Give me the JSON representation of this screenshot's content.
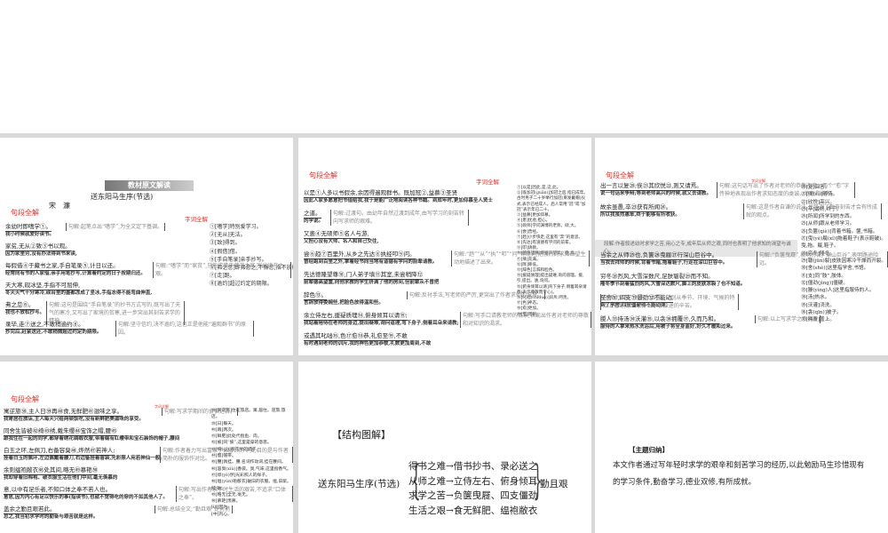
{
  "page1": {
    "banner": "教材原文解读",
    "title": "送东阳马生序(节选)",
    "author": "宋　濂",
    "section_label": "句段全解",
    "gloss_label": "字词全解",
    "lines": [
      {
        "text": "余幼时即嗜学①。",
        "trans": "我小时候就爱好读书。",
        "note": "句解:起笔点出“嗜学”,为全文定下基调。"
      },
      {
        "text": "家贫,无从②致③书以观。",
        "trans": "因为家里穷,没有办法得到书来读,"
      },
      {
        "text": "每假借④于藏书之家,手自笔录⑤,计日以还。",
        "trans": "经常向有书的人家借,亲手用笔抄写,计算着约定的日子按期归还。",
        "note": "句解:“嗜学”而“家贫”,只能求借于藏书之家,写出读书之艰。"
      },
      {
        "text": "天大寒,砚冰坚,手指不可屈伸,",
        "trans": "冬天天气十分寒冷,砚台里的墨都冻成了坚冰,手指冻得不能弯曲伸直,"
      },
      {
        "text": "弗之怠⑥。",
        "trans": "我也不放松抄写。",
        "note": "句解:这句是围绕“手自笔录”的抄书方式写的,既写出了天气的寒冷,又写出了家境的贫寒,进一步突出其刻苦求学的精神。"
      },
      {
        "text": "录毕,走⑦送之,不敢稍逾约⑧。",
        "trans": "抄完后,赶紧送还,不敢稍微超过约定的期限。",
        "note": "句解:坚守信约,决不逾约,这也正是他能“遍观群书”的原因。"
      }
    ],
    "gloss": [
      "①[嗜学]特别爱学习。",
      "②[无从]无法。",
      "③[致]得到。",
      "④[假借]借。",
      "⑤[手自笔录]亲手抄写。",
      "⑥[弗之怠]即弗怠之,不懈怠,指不放松抄书。弗,不。之,指代抄书。",
      "⑦[走]跑。",
      "⑧[逾约]超过约定的期限。"
    ]
  },
  "page2": {
    "section_label": "句段全解",
    "gloss_label": "字词全解",
    "lines": [
      {
        "text": "以是①人多以书假余,余因得遍观群书。既加冠②,益慕③圣贤",
        "trans": "因此人家多愿意把书借给我,我于是能广泛地阅读各种书籍。到成年时,更加仰慕圣人贤士"
      },
      {
        "text": "之道。",
        "trans": "的学说。",
        "note": "句解:过渡句。由幼年自然过渡到成年,由写学习的刻苦转向写求师的艰难。"
      },
      {
        "text": "又患④无硕师⑤名人与游,",
        "trans": "又担心没有大师、名人和自己交往,"
      },
      {
        "text": "尝⑥趋⑦百里外,从乡之先达⑧执经叩⑨问。",
        "trans": "曾经跑到百里之外,拿着经书向当地有道德有学问的前辈请教。",
        "note": "句解:“趋”“从”“执”“叩”“问”等动词,把强烈的求知欲望生动地描述了出来。"
      },
      {
        "text": "先达德隆望尊⑩,门人弟子填⑪其室,未尝稍降⑫",
        "trans": "前辈德高望重,向他求教的学生挤满了他的房间,但前辈从不曾把"
      },
      {
        "text": "辞色⑬。",
        "trans": "言辞放得委婉些,把脸色放得温和些。",
        "note": "句解:反衬手法,写老师的严厉,更突出了作者求师的诚恳。"
      },
      {
        "text": "余立侍左右,援疑质理⑭,俯身倾耳以请⑮;",
        "trans": "我站着陪侍在老师的身边,提出疑难,询问道理,弯下身子,侧着耳朵来请教;",
        "note": "句解:写手口请教老师的情景,表现出作者对老师的尊敬和对知识的渴求。"
      },
      {
        "text": "或遇其叱咄⑯,色⑰愈⑱恭,礼愈至⑲,不敢",
        "trans": "有时遇到老师的训斥,我的神色更加恭敬,礼数更加周到,不敢"
      }
    ],
    "gloss": [
      "①[以是]因此,是,这,此。",
      "②[既加冠(guān)]加冠之后,指已成年。古时男子二十岁举行加冠(束发戴帽)仪式,表示已经成人。后人常用“冠”或“加冠”表示年已二十。",
      "③[益慕]更加仰慕。",
      "④[患]忧虑,担心。",
      "⑤[硕师]学问渊博的老师。硕,大。",
      "⑥[尝]曾经。",
      "⑦[趋]小步快走,这里有“奔”的意思。",
      "⑧[先达]有道德有学问的前辈。",
      "⑨[叩]请教。",
      "⑩[德隆望尊]道德声望高。隆,高。",
      "⑪[填]充满。",
      "⑫[降]降低。",
      "⑬[辞色]言辞和脸色。",
      "⑭[援疑质理]提出疑难,询问道理。援,引,提出。质,询问。",
      "⑮[俯身倾耳以请]弯下身子,侧着耳朵请教(表示尊敬而专心)。",
      "⑯[叱咄(chìduō)]训斥,呵责。",
      "⑰[色]神态。",
      "⑱[愈]更加。",
      "⑲[至]周到。"
    ]
  },
  "page3": {
    "section_label": "句段全解",
    "gloss_label": "字词全解",
    "lines": [
      {
        "text": "出一言以复⑳;俟㉑其欣悦㉒,则又请焉。",
        "trans": "说一句话来争辩;等到老师高兴的时候,就又去请教。",
        "note": "句解:这句话写出了作者对老师的恭敬态度。两个“愈”字传神地表现出作者求知态度的虔诚、恭敬和谦和。"
      },
      {
        "text": "故余虽愚,卒㉓获有所闻㉔。",
        "trans": "所以我虽然愚笨,终于能够有所收获。",
        "note": "句解:这是作者自谦的说法,也强调了勤奋刻苦才会有所成就的观点。"
      },
      {
        "text": "当余之从师㉕也,负箧㉖曳屣㉗行深山巨谷中。",
        "trans": "当我去拜师的时候,背着书箱,拖着鞋子,行走在深山巨谷中。",
        "note": "句解:“负箧曳屣”,表明穷苦;“深山巨谷”,表明路途险远。"
      },
      {
        "text": "穷冬㉘烈风,大雪深数尺,足肤皲裂㉙而不知。",
        "trans": "隆冬季节刮着猛烈的风,大雪深达数尺,脚上的皮肤冻裂了也不知道。"
      },
      {
        "text": "至舍㉚,四支㉛僵劲㉜不能动,",
        "trans": "到了学舍,四肢僵硬得不能动弹,",
        "note": "句解:“穷冬”“烈风”“大雪”,分别从季节、环境、气候的特点上着笔,写出了外出求学旅途的辛苦。"
      },
      {
        "text": "媵人㉝持汤㉞沃灌㉟,以衾㊱拥覆㊲,久而乃和。",
        "trans": "服侍的人拿来热水洗浴后,用被子将全身盖好,好久才暖和过来。",
        "note": "句解:以上写求学之艰辛。"
      }
    ],
    "paragraph_note": "段解:作者叙述幼时求学之苦,用心之专,成年后从师之艰,同时也表明了他求知的渴望与诚心。",
    "gloss": [
      "⑳[复]回答。",
      "㉑[俟(sì)]等待。",
      "㉒[欣悦]高兴。",
      "㉓[卒]最终,终于。",
      "㉔[所闻]所学到的东西。",
      "㉕[从师]跟从老师学习。",
      "㉖[负箧(qiè)]背着书箱。箧,书箱。",
      "㉗[曳(yè)屣(xǐ)]拖着鞋子(表示鞋破)。曳,拖。屣,鞋子。",
      "㉘[穷冬]隆冬。",
      "㉙[皲(jūn)裂]皮肤因寒冷干燥而开裂。",
      "㉚[舍(shè)]这里指学舍,书馆。",
      "㉛[支]同“肢”,肢体。",
      "㉜[僵劲(jìng)]僵硬。",
      "㉝[媵(yìng)人]这里指服侍的人。",
      "㉞[汤]热水。",
      "㉟[沃灌]浇洗。",
      "㊱[衾(qīn)]被子。",
      "㊲[拥覆]盖上。"
    ]
  },
  "page4": {
    "section_label": "句段全解",
    "gloss_label": "字词全解",
    "lines": [
      {
        "text": "寓逆旅㊳,主人日㊴再㊵食,无鲜肥㊶滋味之享。",
        "trans": "我寄居在旅店,主人每天只给两顿饭吃,没有新鲜肥美滋味的享受。",
        "note": "句解:写求学期间的食宿之苦。"
      },
      {
        "text": "同舍生皆被㊷绮㊸绣,戴朱缨㊹宝饰之帽,腰㊺",
        "trans": "跟我住在一起的同学,都穿着绣花绸缎衣服,带着缀有红缨带和宝石装饰的帽子,腰间"
      },
      {
        "text": "白玉之环,左佩刀,右备容臭㊻,烨然㊼若神人;",
        "trans": "挂着白玉的佩环,左边佩戴着腰刀,右边备挂着香袋,光彩照人宛若神仙一般;",
        "note": "句解:作者着力写出富家子弟服饰的华美,目的是与作者简朴的服饰作对比。"
      },
      {
        "text": "余则缊袍敝衣㊽处其间,略无㊾慕艳㊿",
        "trans": "我却穿着旧棉袍、破衣服生活在他们中间,毫无羡慕的"
      },
      {
        "text": "意,以中有足乐者,不知口体之奉不若人也。",
        "trans": "意思,因为内心有足以快乐的事(指读书),也就不觉得吃的穿的不如其他人了。",
        "note": "句解:写出作者求学时生活的艰苦,不追求“口体之奉”。"
      },
      {
        "text": "盖余之勤且艰若此。",
        "trans": "总之,我当初求学时的勤奋与艰苦就是这样。",
        "note": "句解:总结全文,“勤且艰”是对前"
      }
    ],
    "gloss": [
      "㊳[寓逆旅]住在旅店。寓,居住。逆旅,旅店。",
      "㊴[日]每天。",
      "㊵[再]两次。",
      "㊶[鲜肥]此处代指鱼、肉。",
      "㊷[被]同“披”,这里是穿的意思。",
      "㊸[绮(qǐ)]有花纹的绸子。",
      "㊹[缨]帽带。",
      "㊺[腰]佩挂。腰,名词作动词,挂在腰间。",
      "㊻[容臭(xiù)]香袋。臭,气味,这里指香气。",
      "㊼[烨(yè)然]光彩照人的样子。",
      "㊽[缊(yùn)袍敝衣]破旧的衣服。缊,旧絮。敝,破。",
      "㊾[略无]全无,毫无。",
      "㊿[慕艳]羡慕。",
      "[以]因为。",
      "[中]内心。"
    ]
  },
  "page5": {
    "heading": "【结构图解】",
    "root": "送东阳马生序(节选)",
    "branches": [
      "得书之难→借书抄书、录必送之",
      "从师之难→立侍左右、俯身倾耳",
      "求学之苦→负箧曳屣、四支僵劲",
      "生活之艰→食无鲜肥、缊袍敝衣"
    ],
    "result": "勤且艰"
  },
  "page6": {
    "heading": "【主题归纳】",
    "body": "本文作者通过写年轻时求学的艰辛和刻苦学习的经历,以此勉励马生珍惜现有的学习条件,勤奋学习,德业双修,有所成就。"
  },
  "colors": {
    "accent_red": "#d9332b",
    "background": "#d9d9d9"
  }
}
